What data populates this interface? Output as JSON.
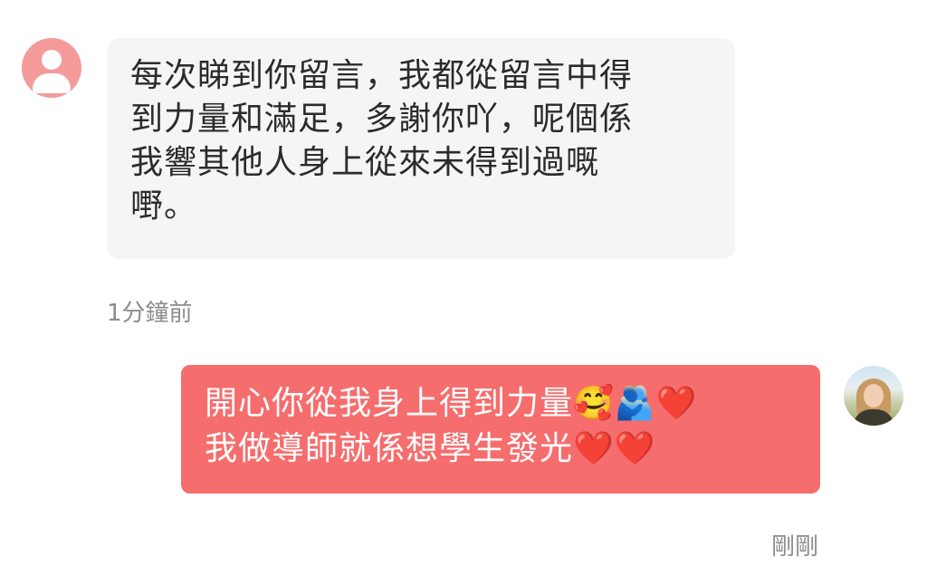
{
  "messages": {
    "incoming": {
      "avatar_icon": "user-icon",
      "text": "每次睇到你留言，我都從留言中得\n到力量和滿足，多謝你吖，呢個係\n我響其他人身上從來未得到過嘅\n嘢。",
      "time": "1分鐘前"
    },
    "outgoing": {
      "avatar_icon": "profile-photo",
      "text": "開心你從我身上得到力量🥰🫂❤️\n我做導師就係想學生發光❤️❤️",
      "time": "剛剛"
    }
  },
  "colors": {
    "incoming_bubble": "#f5f5f5",
    "outgoing_bubble": "#f66d6d",
    "avatar_placeholder": "#f59a9a",
    "timestamp": "#8c8c8c"
  }
}
